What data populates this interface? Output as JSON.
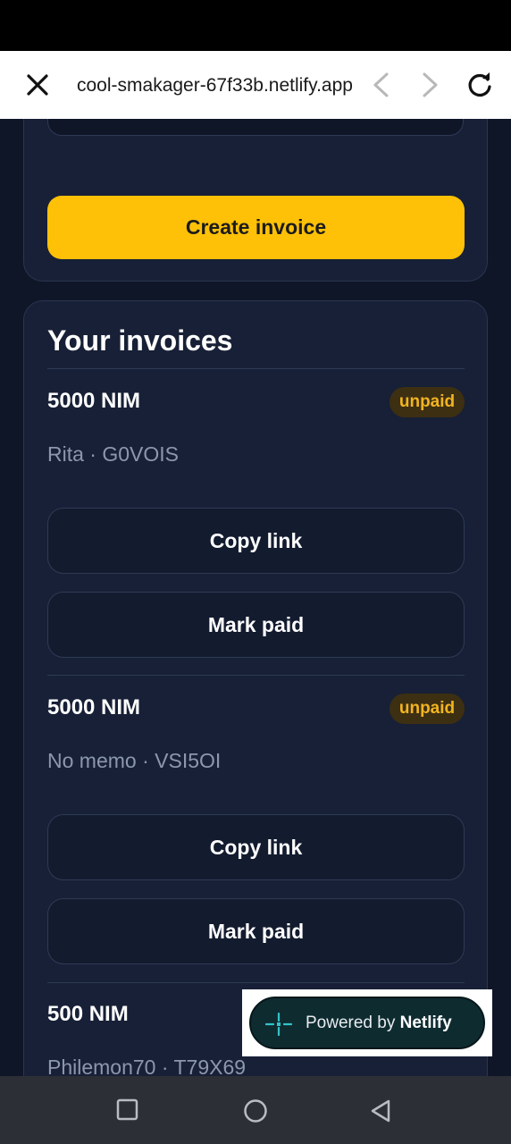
{
  "browser": {
    "url": "cool-smakager-67f33b.netlify.app"
  },
  "form": {
    "create_label": "Create invoice"
  },
  "invoices": {
    "title": "Your invoices",
    "items": [
      {
        "amount": "5000 NIM",
        "status": "unpaid",
        "memo": "Rita · G0VOIS",
        "copy_label": "Copy link",
        "mark_label": "Mark paid"
      },
      {
        "amount": "5000 NIM",
        "status": "unpaid",
        "memo": "No memo · VSI5OI",
        "copy_label": "Copy link",
        "mark_label": "Mark paid"
      },
      {
        "amount": "500 NIM",
        "memo": "Philemon70 · T79X69"
      }
    ]
  },
  "netlify_badge": {
    "prefix": "Powered by ",
    "brand": "Netlify"
  },
  "colors": {
    "accent": "#ffc107",
    "background": "#0f1628",
    "card": "#172036",
    "badge_text": "#f2b420"
  },
  "icons": [
    "close-icon",
    "back-icon",
    "forward-icon",
    "reload-icon",
    "netlify-logo-icon",
    "recent-apps-icon",
    "home-icon",
    "nav-back-icon"
  ]
}
